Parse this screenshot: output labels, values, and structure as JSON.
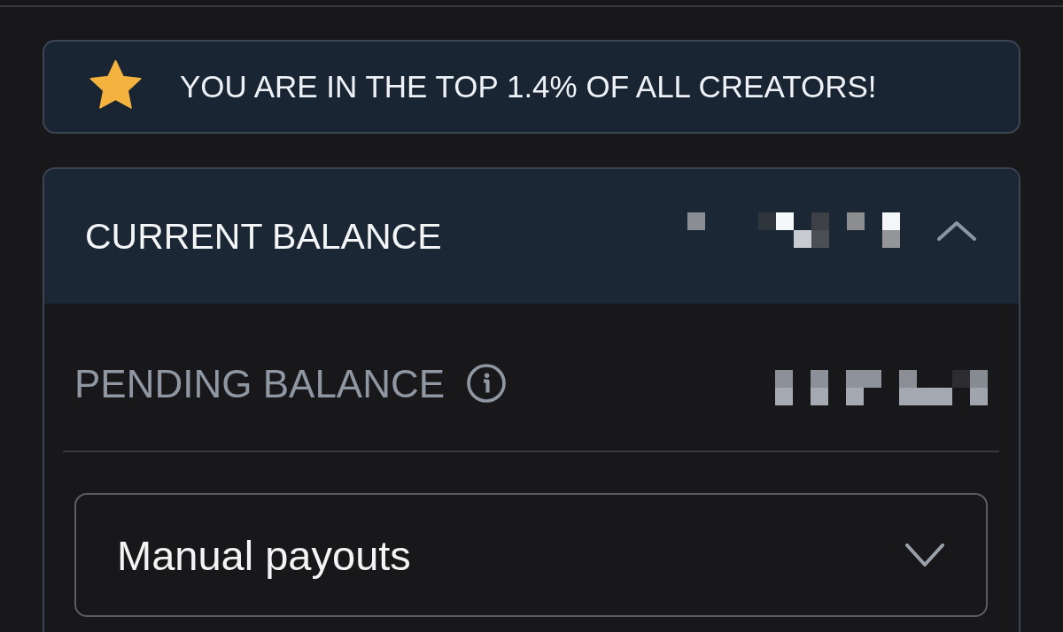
{
  "top_banner": {
    "text": "YOU ARE IN THE TOP 1.4% OF ALL CREATORS!"
  },
  "balance_panel": {
    "title": "CURRENT BALANCE",
    "expanded": true,
    "pending": {
      "label": "PENDING BALANCE"
    },
    "payout_select": {
      "value": "Manual payouts",
      "expanded": false
    }
  }
}
